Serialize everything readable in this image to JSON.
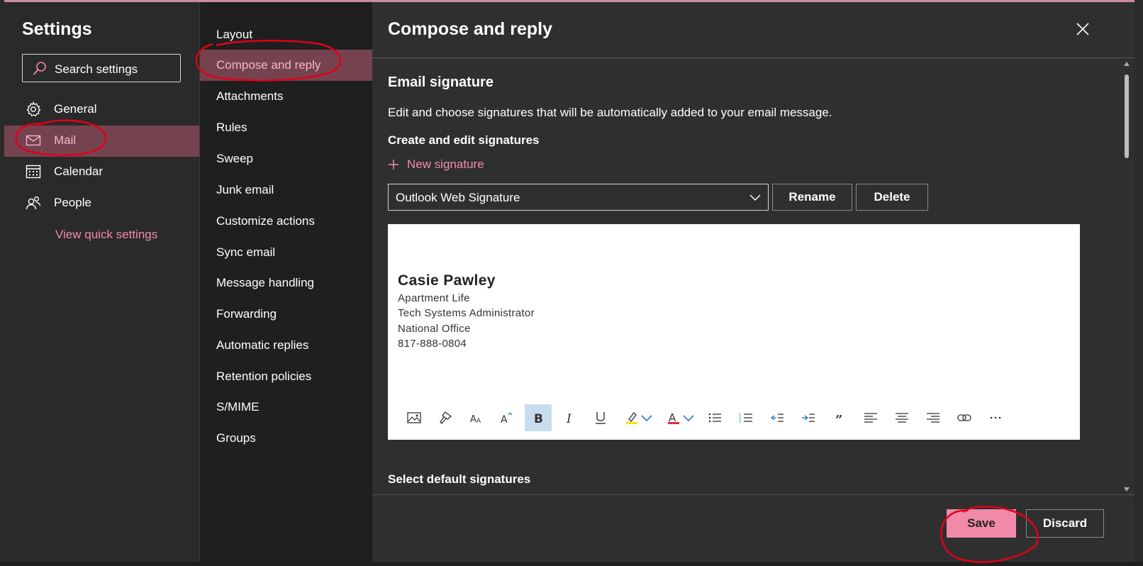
{
  "settings": {
    "title": "Settings",
    "search_placeholder": "Search settings",
    "nav": [
      {
        "label": "General",
        "icon": "gear-icon"
      },
      {
        "label": "Mail",
        "icon": "mail-icon",
        "active": true
      },
      {
        "label": "Calendar",
        "icon": "calendar-icon"
      },
      {
        "label": "People",
        "icon": "people-icon"
      }
    ],
    "quick_settings_link": "View quick settings"
  },
  "mail_nav": [
    "Layout",
    "Compose and reply",
    "Attachments",
    "Rules",
    "Sweep",
    "Junk email",
    "Customize actions",
    "Sync email",
    "Message handling",
    "Forwarding",
    "Automatic replies",
    "Retention policies",
    "S/MIME",
    "Groups"
  ],
  "mail_nav_active": "Compose and reply",
  "panel": {
    "title": "Compose and reply",
    "section_title": "Email signature",
    "section_desc": "Edit and choose signatures that will be automatically added to your email message.",
    "subsection": "Create and edit signatures",
    "new_signature": "New signature",
    "signature_selected": "Outlook Web Signature",
    "rename_label": "Rename",
    "delete_label": "Delete",
    "signature": {
      "name": "Casie Pawley",
      "lines": [
        "Apartment Life",
        "Tech Systems Administrator",
        "National Office",
        "817-888-0804"
      ]
    },
    "toolbar": [
      "image-icon",
      "format-painter-icon",
      "font-size-icon",
      "grow-font-icon",
      "bold-icon",
      "italic-icon",
      "underline-icon",
      "highlight-icon",
      "font-color-icon",
      "bullets-icon",
      "numbering-icon",
      "decrease-indent-icon",
      "increase-indent-icon",
      "quote-icon",
      "align-left-icon",
      "align-center-icon",
      "align-right-icon",
      "link-icon",
      "more-icon"
    ],
    "default_section": "Select default signatures",
    "save_label": "Save",
    "discard_label": "Discard"
  },
  "colors": {
    "accent": "#f08ab0",
    "active_bg": "#75434f",
    "primary_button": "#f08aa8",
    "annotation": "#e0001a"
  }
}
